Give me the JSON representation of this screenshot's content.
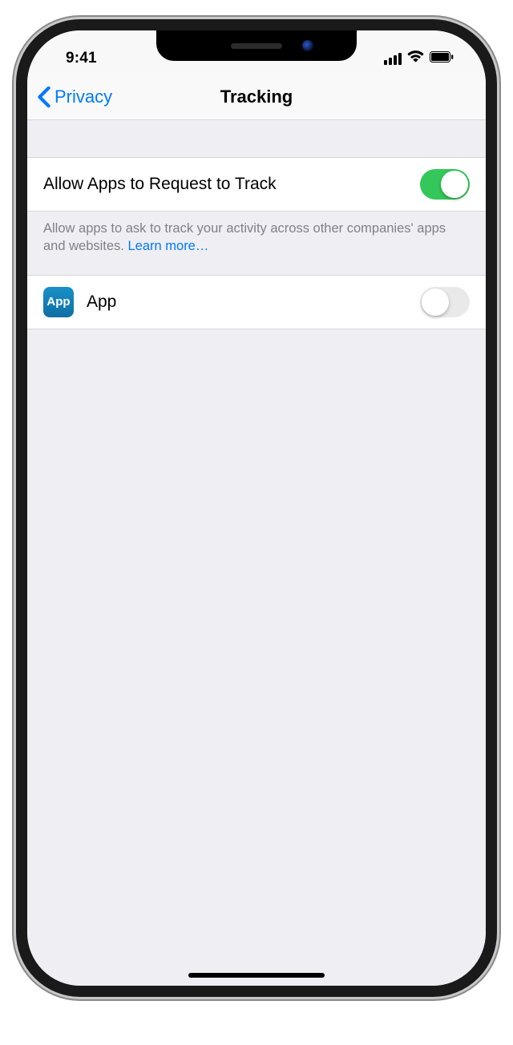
{
  "status": {
    "time": "9:41"
  },
  "nav": {
    "back_label": "Privacy",
    "title": "Tracking"
  },
  "settings": {
    "allow_request": {
      "label": "Allow Apps to Request to Track",
      "value": true,
      "footer": "Allow apps to ask to track your activity across other companies' apps and websites. ",
      "learn_more": "Learn more…"
    },
    "apps": [
      {
        "icon_text": "App",
        "name": "App",
        "value": false
      }
    ]
  }
}
